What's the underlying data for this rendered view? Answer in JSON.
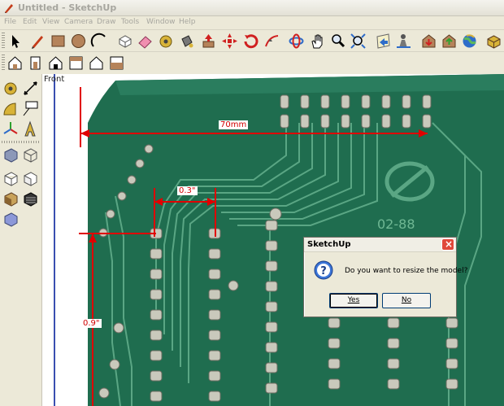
{
  "window": {
    "title": "Untitled - SketchUp"
  },
  "menu": [
    "File",
    "Edit",
    "View",
    "Camera",
    "Draw",
    "Tools",
    "Window",
    "Help"
  ],
  "toolbar_main": [
    "select-tool",
    "pencil-line-tool",
    "rectangle-tool",
    "circle-tool",
    "arc-tool",
    "make-component-tool",
    "eraser-tool",
    "tape-measure-tool",
    "paint-bucket-tool",
    "push-pull-tool",
    "move-tool",
    "rotate-tool",
    "follow-me-tool",
    "orbit-tool",
    "pan-tool",
    "zoom-tool",
    "zoom-extents-tool",
    "previous-view-tool",
    "position-camera-tool",
    "walk-tool",
    "get-models-tool",
    "share-model-tool",
    "components-tool"
  ],
  "toolbar_views": [
    "iso-view",
    "front-view",
    "back-view",
    "top-view",
    "right-view",
    "left-view"
  ],
  "palette": [
    "tape-measure-tool",
    "dimension-tool",
    "protractor-tool",
    "text-tool",
    "axes-tool",
    "3d-text-tool",
    "xray-style",
    "wireframe-style",
    "hidden-line-style",
    "shaded-style",
    "shaded-textures-style",
    "monochrome-style"
  ],
  "viewport": {
    "view_name": "Front",
    "dimensions": {
      "width_70": "70mm",
      "pitch": "0.3\"",
      "height": "0.9\""
    }
  },
  "dialog": {
    "title": "SketchUp",
    "message": "Do you want to resize the model?",
    "yes_label": "Yes",
    "no_label": "No"
  },
  "colors": {
    "pcb_green": "#1f6d4f",
    "trace_green": "#4f9a78",
    "dimension_red": "#e00000",
    "dialog_bg": "#ece9d8"
  }
}
